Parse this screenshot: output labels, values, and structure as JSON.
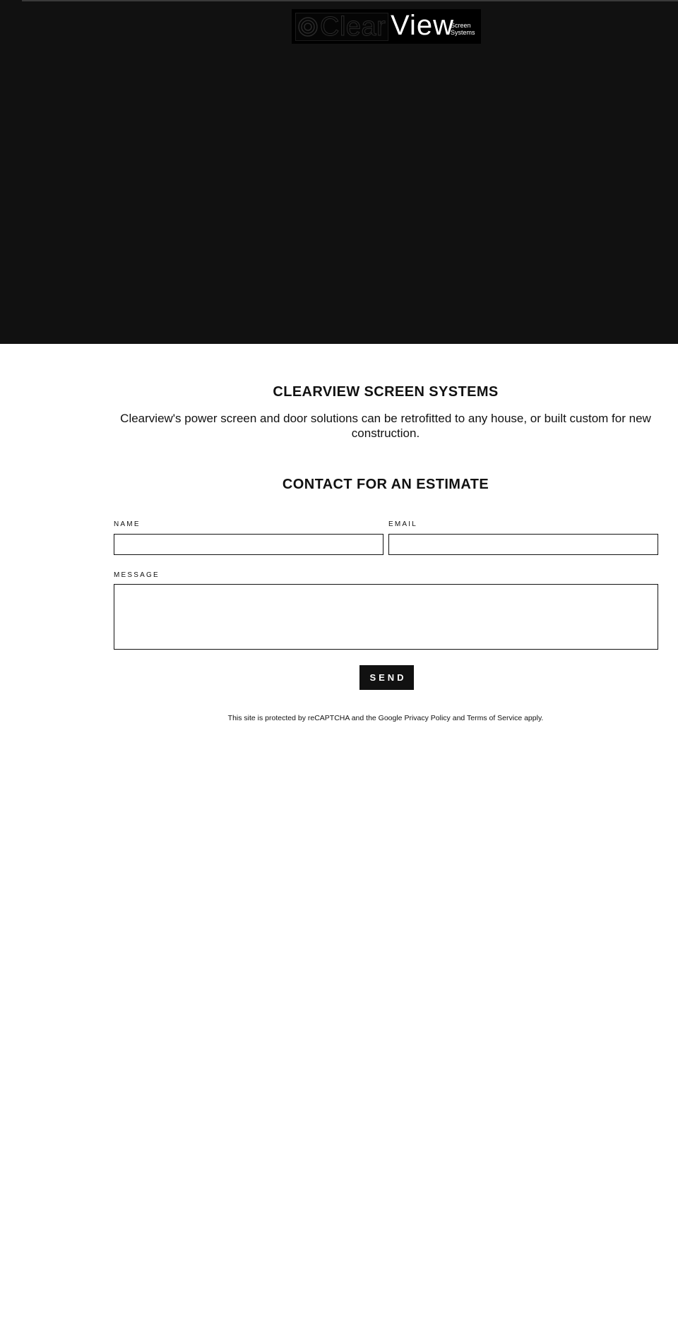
{
  "header": {
    "logo": {
      "word_left": "Clear",
      "word_right": "View",
      "sub_line_1": "Screen",
      "sub_line_2": "Systems"
    }
  },
  "about": {
    "title": "CLEARVIEW SCREEN SYSTEMS",
    "body": "Clearview's power screen and door solutions can be retrofitted to any house, or built custom for new construction."
  },
  "contact": {
    "title": "CONTACT FOR AN ESTIMATE",
    "name_label": "NAME",
    "email_label": "EMAIL",
    "message_label": "MESSAGE",
    "name_value": "",
    "email_value": "",
    "message_value": "",
    "send_label": "SEND",
    "recaptcha": {
      "prefix": "This site is protected by reCAPTCHA and the Google ",
      "privacy_link": "Privacy Policy",
      "middle": " and ",
      "terms_link": "Terms of Service",
      "suffix": " apply."
    }
  },
  "colors": {
    "hero_background": "#111111",
    "page_background": "#ffffff",
    "button_background": "#111111",
    "text": "#111111"
  },
  "icons": {
    "logo_mark": "concentric-circles-icon"
  }
}
